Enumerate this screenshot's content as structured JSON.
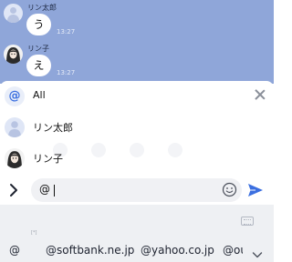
{
  "chat": {
    "messages": [
      {
        "sender": "リン太郎",
        "text": "う",
        "time": "13:27",
        "avatar": "default-avatar"
      },
      {
        "sender": "リン子",
        "text": "え",
        "time": "13:27",
        "avatar": "photo-avatar"
      }
    ]
  },
  "mention": {
    "items": [
      {
        "label": "All",
        "icon": "at-icon"
      },
      {
        "label": "リン太郎",
        "icon": "default-avatar"
      },
      {
        "label": "リン子",
        "icon": "photo-avatar"
      }
    ],
    "close_icon": "close-icon"
  },
  "composer": {
    "value": "@",
    "emoji_icon": "emoji-icon",
    "send_icon": "send-icon",
    "accent": "#3b6fe0"
  },
  "keyboard": {
    "indicator": "[*]",
    "suggestions": [
      "@",
      "@softbank.ne.jp",
      "@yahoo.co.jp",
      "@ou"
    ]
  },
  "colors": {
    "chat_background": "#8fa6d9",
    "panel_background": "#ffffff",
    "keyboard_background": "#eef0f3"
  }
}
